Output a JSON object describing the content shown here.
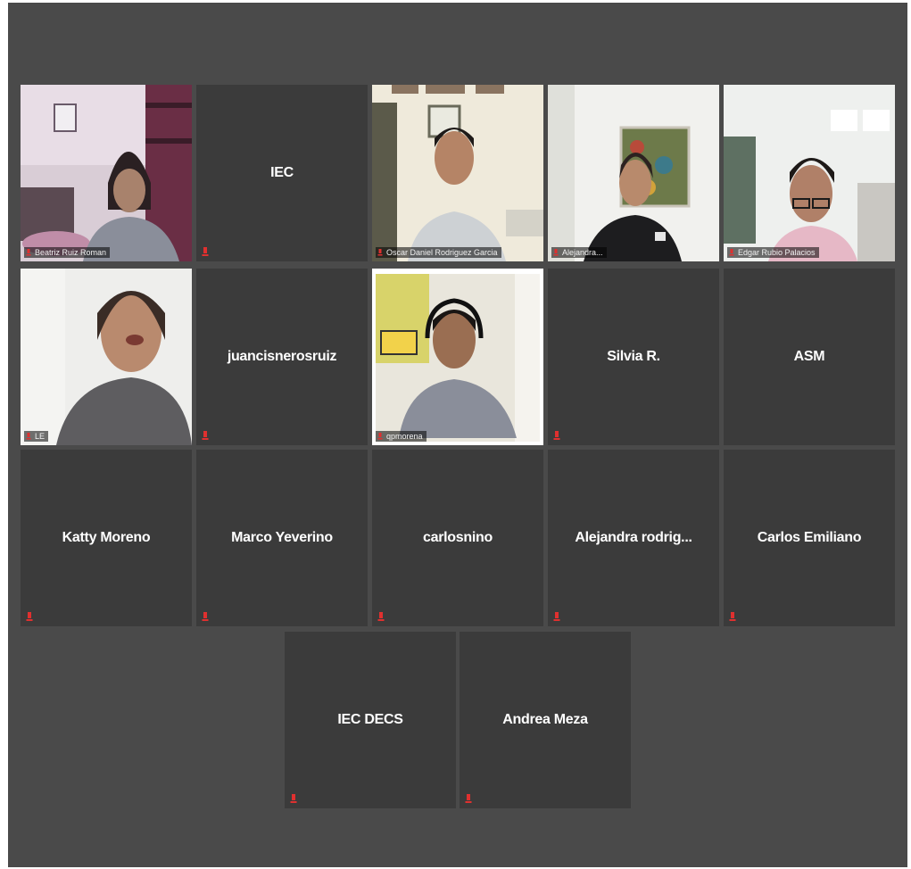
{
  "participants": [
    {
      "name": "Beatriz Ruiz Roman",
      "video": true
    },
    {
      "name": "IEC",
      "video": false
    },
    {
      "name": "Oscar Daniel Rodriguez Garcia",
      "video": true
    },
    {
      "name": "Alejandra...",
      "video": true
    },
    {
      "name": "Edgar Rubio Palacios",
      "video": true
    },
    {
      "name": "LE",
      "video": true
    },
    {
      "name": "juancisnerosruiz",
      "video": false
    },
    {
      "name": "qpmorena",
      "video": true
    },
    {
      "name": "Silvia R.",
      "video": false
    },
    {
      "name": "ASM",
      "video": false
    },
    {
      "name": "Katty Moreno",
      "video": false
    },
    {
      "name": "Marco Yeverino",
      "video": false
    },
    {
      "name": "carlosnino",
      "video": false
    },
    {
      "name": "Alejandra rodrig...",
      "video": false
    },
    {
      "name": "Carlos Emiliano",
      "video": false
    },
    {
      "name": "IEC DECS",
      "video": false
    },
    {
      "name": "Andrea Meza",
      "video": false
    }
  ],
  "colors": {
    "background": "#4a4a4a",
    "tile": "#3b3b3b",
    "active_speaker_border": "#e7e35a",
    "muted_icon": "#e0302f",
    "name_text": "#ffffff"
  },
  "icons": {
    "muted": "mic-muted-icon"
  }
}
